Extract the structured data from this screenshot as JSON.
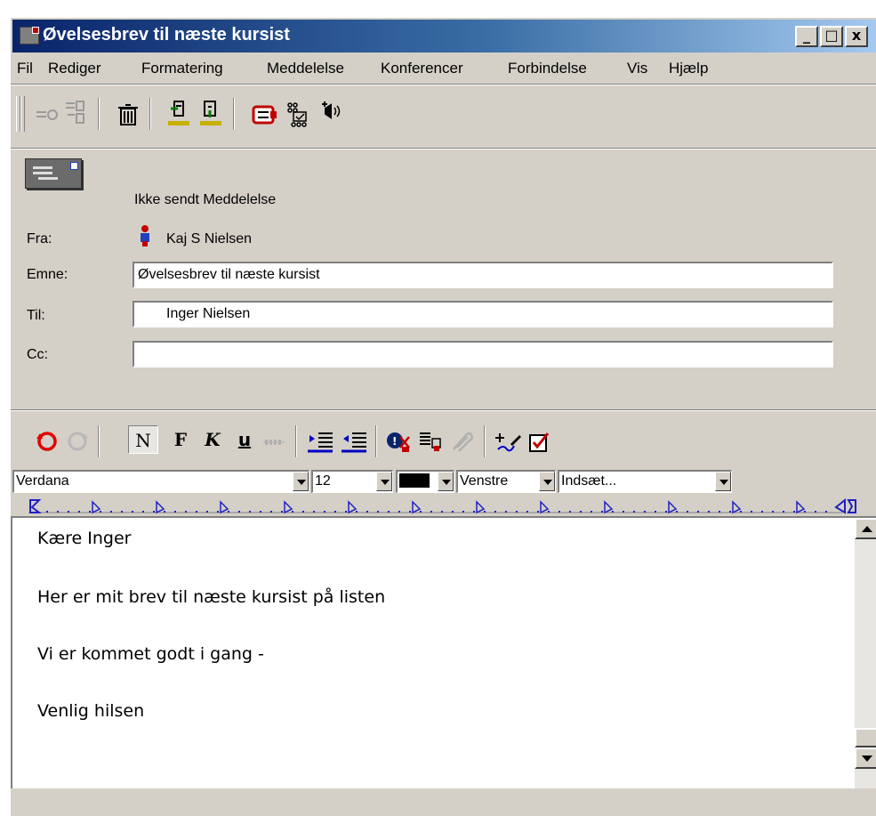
{
  "window": {
    "title": "Øvelsesbrev til næste kursist",
    "buttons": {
      "minimize": "_",
      "maximize": "□",
      "close": "x"
    }
  },
  "menu": [
    "Fil",
    "Rediger",
    "Formatering",
    "Meddelelse",
    "Konferencer",
    "Forbindelse",
    "Vis",
    "Hjælp"
  ],
  "toolbar": {
    "icons": [
      "reply-icon",
      "reply-all-icon",
      "delete-icon",
      "send-icon",
      "save-icon",
      "address-book-icon",
      "check-names-icon",
      "voice-icon"
    ]
  },
  "header": {
    "status": "Ikke sendt Meddelelse",
    "from_label": "Fra:",
    "from_value": "Kaj S Nielsen",
    "subject_label": "Emne:",
    "subject_value": "Øvelsesbrev til næste kursist",
    "to_label": "Til:",
    "to_value": "Inger Nielsen",
    "cc_label": "Cc:",
    "cc_value": ""
  },
  "format_toolbar": {
    "normal": "N",
    "bold": "F",
    "italic": "K",
    "underline": "u"
  },
  "format_controls": {
    "font": "Verdana",
    "size": "12",
    "align": "Venstre",
    "insert": "Indsæt..."
  },
  "body": {
    "lines": [
      "Kære Inger",
      "Her er mit brev til næste kursist på listen",
      "Vi er kommet godt i gang -",
      "Venlig hilsen"
    ]
  }
}
